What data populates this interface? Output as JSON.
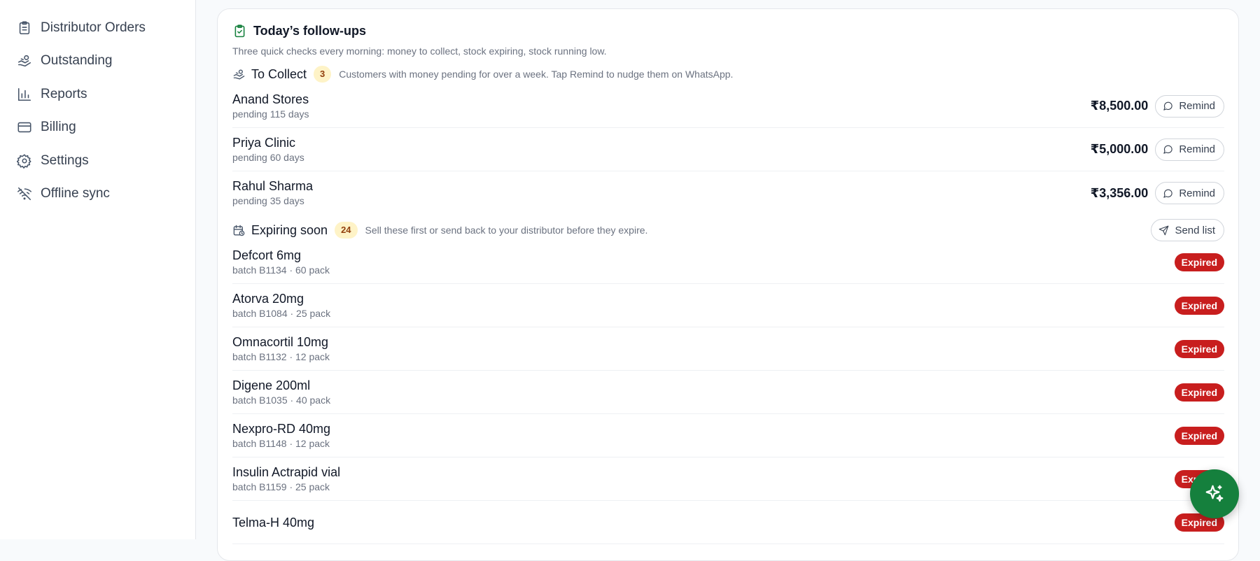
{
  "sidebar": {
    "items": [
      {
        "label": "Distributor Orders",
        "icon": "clipboard-icon"
      },
      {
        "label": "Outstanding",
        "icon": "hand-coins-icon"
      },
      {
        "label": "Reports",
        "icon": "bar-chart-icon"
      },
      {
        "label": "Billing",
        "icon": "credit-card-icon"
      },
      {
        "label": "Settings",
        "icon": "gear-icon"
      },
      {
        "label": "Offline sync",
        "icon": "wifi-off-icon"
      }
    ]
  },
  "followups": {
    "title": "Today’s follow-ups",
    "subtitle": "Three quick checks every morning: money to collect, stock expiring, stock running low.",
    "collect": {
      "title": "To Collect",
      "count": "3",
      "description": "Customers with money pending for over a week. Tap Remind to nudge them on WhatsApp.",
      "remind_label": "Remind",
      "rows": [
        {
          "name": "Anand Stores",
          "meta": "pending 115 days",
          "amount": "₹8,500.00"
        },
        {
          "name": "Priya Clinic",
          "meta": "pending 60 days",
          "amount": "₹5,000.00"
        },
        {
          "name": "Rahul Sharma",
          "meta": "pending 35 days",
          "amount": "₹3,356.00"
        }
      ]
    },
    "expiring": {
      "title": "Expiring soon",
      "count": "24",
      "description": "Sell these first or send back to your distributor before they expire.",
      "send_label": "Send list",
      "status_label": "Expired",
      "rows": [
        {
          "name": "Defcort 6mg",
          "meta": "batch B1134 · 60 pack"
        },
        {
          "name": "Atorva 20mg",
          "meta": "batch B1084 · 25 pack"
        },
        {
          "name": "Omnacortil 10mg",
          "meta": "batch B1132 · 12 pack"
        },
        {
          "name": "Digene 200ml",
          "meta": "batch B1035 · 40 pack"
        },
        {
          "name": "Nexpro-RD 40mg",
          "meta": "batch B1148 · 12 pack"
        },
        {
          "name": "Insulin Actrapid vial",
          "meta": "batch B1159 · 25 pack"
        },
        {
          "name": "Telma-H 40mg",
          "meta": ""
        }
      ]
    }
  },
  "colors": {
    "accent": "#15803d",
    "expired": "#c81e1e",
    "badge_bg": "#fef3c7"
  },
  "fab_icon": "sparkles-icon"
}
